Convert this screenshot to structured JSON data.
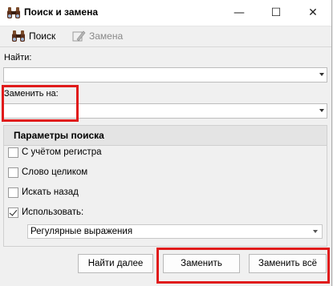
{
  "window": {
    "title": "Поиск и замена",
    "minimize_glyph": "—",
    "maximize_glyph": "☐",
    "close_glyph": "✕"
  },
  "toolbar": {
    "search_label": "Поиск",
    "replace_label": "Замена"
  },
  "find": {
    "label": "Найти:",
    "value": ""
  },
  "replace": {
    "label": "Заменить на:",
    "value": ""
  },
  "options": {
    "header": "Параметры поиска",
    "items": [
      {
        "label": "С учётом регистра",
        "checked": false
      },
      {
        "label": "Слово целиком",
        "checked": false
      },
      {
        "label": "Искать назад",
        "checked": false
      },
      {
        "label": "Использовать:",
        "checked": true
      }
    ],
    "use_mode": "Регулярные выражения"
  },
  "buttons": {
    "find_next": "Найти далее",
    "replace": "Заменить",
    "replace_all": "Заменить всё"
  },
  "colors": {
    "highlight": "#e01b1b",
    "title_bar": "#ffffff",
    "background": "#f0f0f0"
  },
  "icons": {
    "app": "binoculars-icon",
    "search": "binoculars-icon",
    "replace": "replace-pen-icon"
  }
}
